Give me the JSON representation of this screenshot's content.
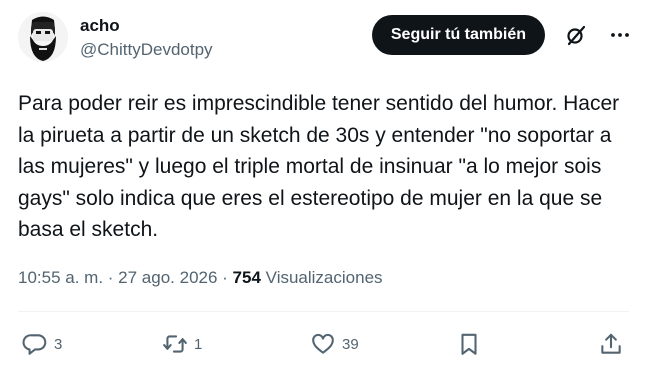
{
  "author": {
    "display_name": "acho",
    "handle": "@ChittyDevdotpy",
    "avatar_icon": "bearded-man-avatar-icon"
  },
  "header": {
    "follow_label": "Seguir tú también",
    "grok_icon": "grok-icon",
    "more_icon": "more-options-icon"
  },
  "tweet": {
    "text": "Para poder reir es imprescindible tener sentido del humor. Hacer la pirueta a partir de un sketch de 30s y entender \"no soportar a las mujeres\" y luego el triple mortal de insinuar \"a lo mejor sois gays\" solo indica que eres el estereotipo de mujer en la que se basa el sketch.",
    "time": "10:55 a. m.",
    "date": "27 ago. 2026",
    "views_count": "754",
    "views_label": "Visualizaciones"
  },
  "actions": {
    "replies": "3",
    "retweets": "1",
    "likes": "39"
  },
  "colors": {
    "text": "#0f1419",
    "secondary": "#536471",
    "button_bg": "#0f1419",
    "divider": "#eff3f4"
  }
}
